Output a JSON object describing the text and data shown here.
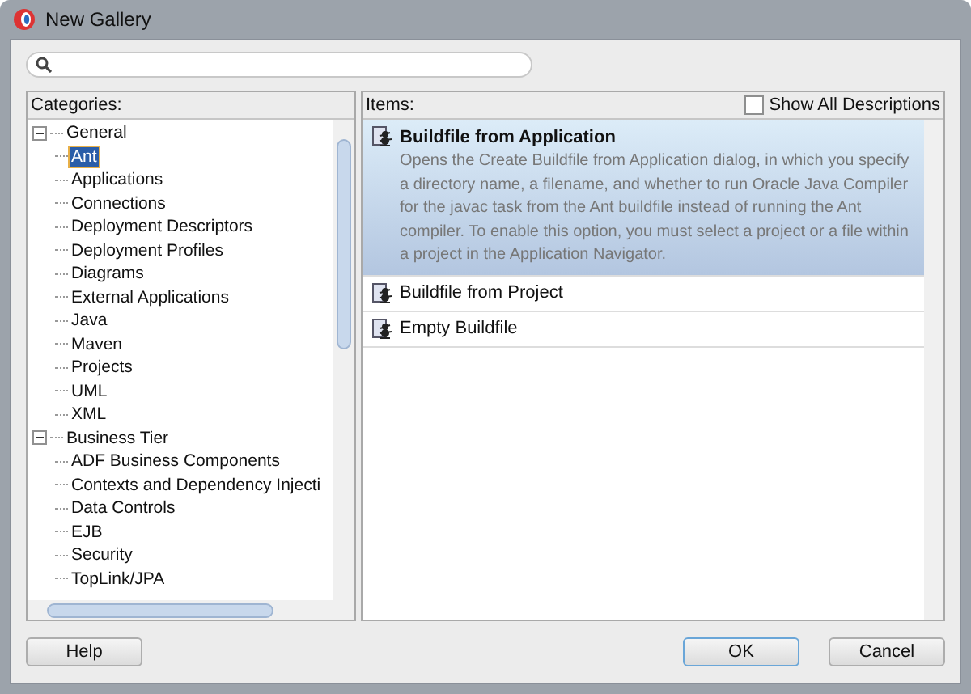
{
  "window": {
    "title": "New Gallery"
  },
  "categories": {
    "label": "Categories:",
    "tree": [
      {
        "label": "General",
        "expanded": true,
        "selected": false,
        "children": [
          {
            "label": "Ant",
            "selected": true
          },
          {
            "label": "Applications",
            "selected": false
          },
          {
            "label": "Connections",
            "selected": false
          },
          {
            "label": "Deployment Descriptors",
            "selected": false
          },
          {
            "label": "Deployment Profiles",
            "selected": false
          },
          {
            "label": "Diagrams",
            "selected": false
          },
          {
            "label": "External Applications",
            "selected": false
          },
          {
            "label": "Java",
            "selected": false
          },
          {
            "label": "Maven",
            "selected": false
          },
          {
            "label": "Projects",
            "selected": false
          },
          {
            "label": "UML",
            "selected": false
          },
          {
            "label": "XML",
            "selected": false
          }
        ]
      },
      {
        "label": "Business Tier",
        "expanded": true,
        "selected": false,
        "children": [
          {
            "label": "ADF Business Components",
            "selected": false
          },
          {
            "label": "Contexts and Dependency Injecti",
            "selected": false
          },
          {
            "label": "Data Controls",
            "selected": false
          },
          {
            "label": "EJB",
            "selected": false
          },
          {
            "label": "Security",
            "selected": false
          },
          {
            "label": "TopLink/JPA",
            "selected": false
          }
        ]
      }
    ]
  },
  "items": {
    "label": "Items:",
    "show_all_descriptions": {
      "label": "Show All Descriptions",
      "checked": false
    },
    "list": [
      {
        "title": "Buildfile from Application",
        "selected": true,
        "description": "Opens the Create Buildfile from Application dialog, in which you specify a directory name, a filename, and whether to run Oracle Java Compiler for the javac task from the Ant buildfile instead of running the Ant compiler. To enable this option, you must select a project or a file within a project in the Application Navigator."
      },
      {
        "title": "Buildfile from Project",
        "selected": false
      },
      {
        "title": "Empty Buildfile",
        "selected": false
      }
    ]
  },
  "buttons": [
    {
      "label": "Help",
      "kind": "help"
    },
    {
      "label": "OK",
      "kind": "default"
    },
    {
      "label": "Cancel",
      "kind": "normal"
    }
  ]
}
